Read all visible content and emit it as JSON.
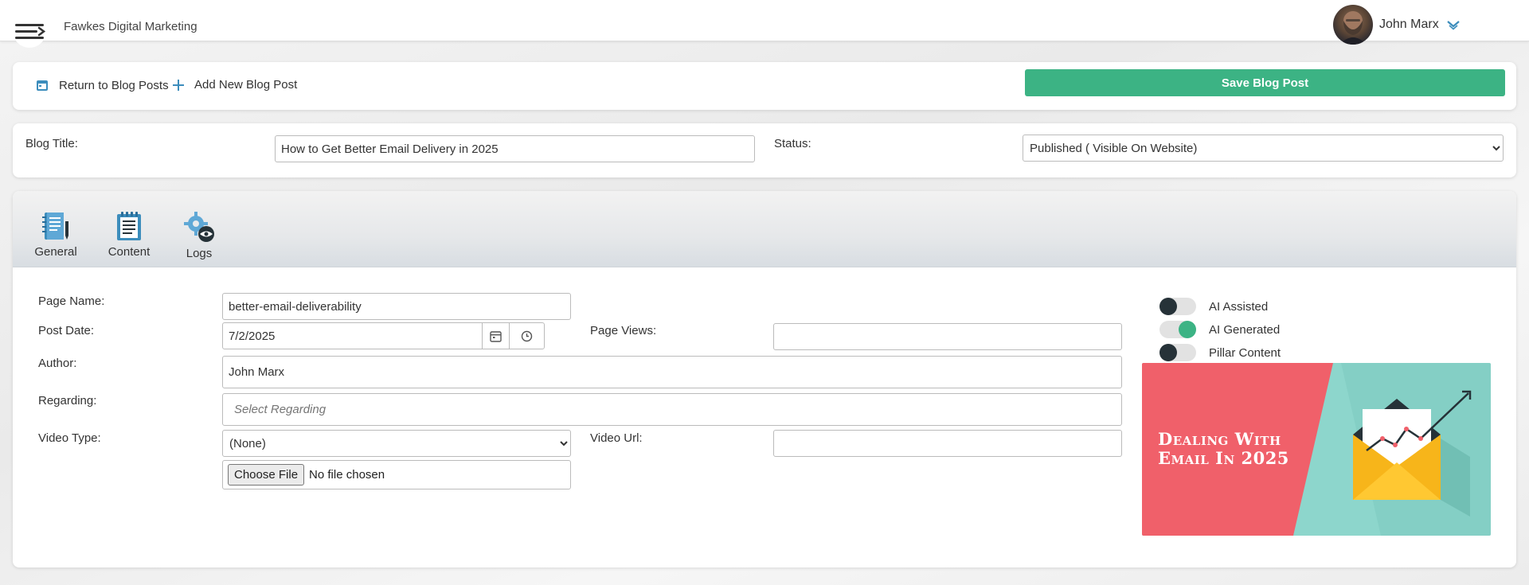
{
  "header": {
    "company": "Fawkes Digital Marketing",
    "user_name": "John Marx"
  },
  "actions": {
    "return_label": "Return to Blog Posts",
    "add_label": "Add New Blog Post",
    "save_label": "Save Blog Post"
  },
  "blog": {
    "title_label": "Blog Title:",
    "title_value": "How to Get Better Email Delivery in 2025",
    "status_label": "Status:",
    "status_value": "Published ( Visible On Website)"
  },
  "tabs": [
    {
      "label": "General",
      "icon": "notebook-icon"
    },
    {
      "label": "Content",
      "icon": "document-icon"
    },
    {
      "label": "Logs",
      "icon": "gear-eye-icon"
    }
  ],
  "form": {
    "page_name_label": "Page Name:",
    "page_name_value": "better-email-deliverability",
    "post_date_label": "Post Date:",
    "post_date_value": "7/2/2025",
    "page_views_label": "Page Views:",
    "page_views_value": "",
    "author_label": "Author:",
    "author_value": "John Marx",
    "regarding_label": "Regarding:",
    "regarding_placeholder": "Select Regarding",
    "video_type_label": "Video Type:",
    "video_type_value": "(None)",
    "video_url_label": "Video Url:",
    "video_url_value": "",
    "file_button": "Choose File",
    "file_status": "No file chosen"
  },
  "toggles": [
    {
      "label": "AI Assisted",
      "on": false
    },
    {
      "label": "AI Generated",
      "on": true
    },
    {
      "label": "Pillar Content",
      "on": false
    }
  ],
  "thumbnail": {
    "line1": "Dealing With",
    "line2": "Email In 2025"
  },
  "colors": {
    "accent_green": "#3cb384",
    "thumb_red": "#f0606a",
    "thumb_teal": "#8dd6cc"
  }
}
